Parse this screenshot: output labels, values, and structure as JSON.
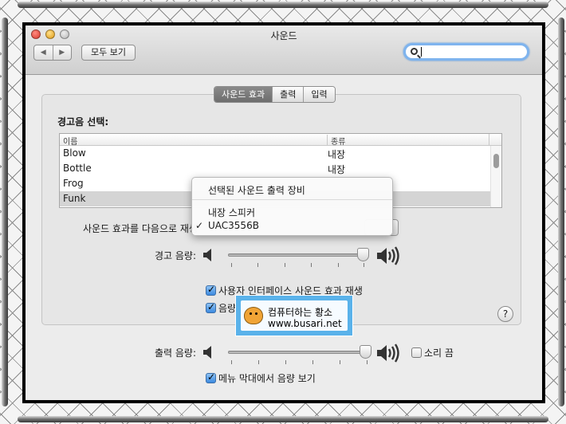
{
  "window": {
    "title": "사운드"
  },
  "toolbar": {
    "back_label": "◀",
    "forward_label": "▶",
    "show_all_label": "모두 보기",
    "search_placeholder": ""
  },
  "tabs": [
    {
      "label": "사운드 효과",
      "active": true
    },
    {
      "label": "출력",
      "active": false
    },
    {
      "label": "입력",
      "active": false
    }
  ],
  "sound_effects": {
    "alert_label": "경고음 선택:",
    "columns": [
      "이름",
      "종류"
    ],
    "rows": [
      {
        "name": "Blow",
        "type": "내장"
      },
      {
        "name": "Bottle",
        "type": "내장"
      },
      {
        "name": "Frog",
        "type": ""
      },
      {
        "name": "Funk",
        "type": ""
      }
    ],
    "play_through_label": "사운드 효과를 다음으로 재생",
    "alert_volume_label": "경고 음량:",
    "alert_volume": 0.96,
    "ui_sounds_label": "사용자 인터페이스 사운드 효과 재생",
    "ui_sounds_checked": true,
    "feedback_label": "음량",
    "feedback_checked": true
  },
  "output": {
    "volume_label": "출력 음량:",
    "volume": 0.96,
    "mute_label": "소리 끔",
    "mute_checked": false,
    "menubar_label": "메뉴 막대에서 음량 보기",
    "menubar_checked": true
  },
  "dropdown": {
    "header": "선택된 사운드 출력 장비",
    "items": [
      {
        "label": "내장 스피커",
        "checked": false
      },
      {
        "label": "UAC3556B",
        "checked": true
      }
    ]
  },
  "help_label": "?",
  "watermark": {
    "line1": "컴퓨터하는 황소",
    "line2": "www.busari.net"
  },
  "colors": {
    "accent": "#3c8ae0",
    "search_ring": "#7fb4ee",
    "watermark_bg": "#5ab2ea"
  }
}
